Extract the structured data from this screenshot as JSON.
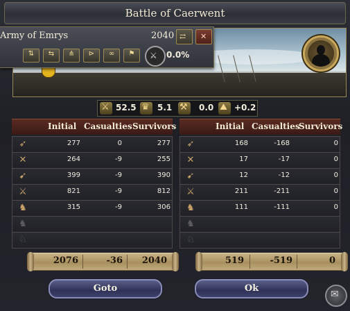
{
  "window": {
    "title": "Battle of Caerwent"
  },
  "army": {
    "name": "Army of Emrys",
    "size": "2040",
    "reinforce_percent": "0.0%",
    "icons": [
      "transfer-troops-icon",
      "close-icon",
      "formation-icon",
      "swap-icon",
      "march-icon",
      "raise-icon",
      "link-icon",
      "flag-icon",
      "reinforce-icon"
    ]
  },
  "modifiers": [
    {
      "icon": "crossed-swords-icon",
      "value": "52.5"
    },
    {
      "icon": "crown-icon",
      "value": "5.1"
    },
    {
      "icon": "commander-icon",
      "value": "0.0"
    },
    {
      "icon": "terrain-icon",
      "value": "+0.2"
    }
  ],
  "headers": {
    "initial": "Initial",
    "casualties": "Casualties",
    "survivors": "Survivors"
  },
  "attacker": {
    "rows": [
      {
        "unit": "archers-icon",
        "initial": "277",
        "casualties": "0",
        "survivors": "277"
      },
      {
        "unit": "pikemen-icon",
        "initial": "264",
        "casualties": "-9",
        "survivors": "255"
      },
      {
        "unit": "light-infantry-icon",
        "initial": "399",
        "casualties": "-9",
        "survivors": "390"
      },
      {
        "unit": "heavy-infantry-icon",
        "initial": "821",
        "casualties": "-9",
        "survivors": "812"
      },
      {
        "unit": "light-cavalry-icon",
        "initial": "315",
        "casualties": "-9",
        "survivors": "306"
      },
      {
        "unit": "knights-icon",
        "initial": "",
        "casualties": "",
        "survivors": ""
      },
      {
        "unit": "horse-archers-icon",
        "initial": "",
        "casualties": "",
        "survivors": ""
      }
    ],
    "totals": {
      "initial": "2076",
      "casualties": "-36",
      "survivors": "2040"
    }
  },
  "defender": {
    "rows": [
      {
        "unit": "archers-icon",
        "initial": "168",
        "casualties": "-168",
        "survivors": "0"
      },
      {
        "unit": "pikemen-icon",
        "initial": "17",
        "casualties": "-17",
        "survivors": "0"
      },
      {
        "unit": "light-infantry-icon",
        "initial": "12",
        "casualties": "-12",
        "survivors": "0"
      },
      {
        "unit": "heavy-infantry-icon",
        "initial": "211",
        "casualties": "-211",
        "survivors": "0"
      },
      {
        "unit": "light-cavalry-icon",
        "initial": "111",
        "casualties": "-111",
        "survivors": "0"
      },
      {
        "unit": "knights-icon",
        "initial": "",
        "casualties": "",
        "survivors": ""
      },
      {
        "unit": "horse-archers-icon",
        "initial": "",
        "casualties": "",
        "survivors": ""
      }
    ],
    "totals": {
      "initial": "519",
      "casualties": "-519",
      "survivors": "0"
    }
  },
  "buttons": {
    "goto": "Goto",
    "ok": "Ok"
  }
}
